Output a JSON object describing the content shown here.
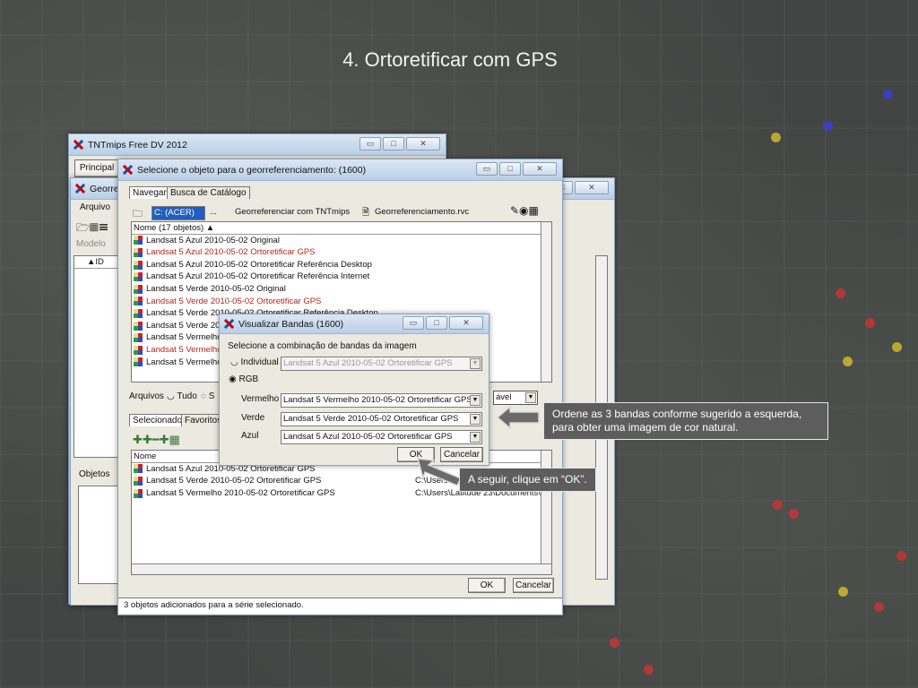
{
  "slide": {
    "title": "4. Ortoretificar com GPS"
  },
  "tnt_window": {
    "title": "TNTmips Free DV 2012",
    "menu_principal": "Principal"
  },
  "georef_window": {
    "title": "Georrefe",
    "menu_arquivo": "Arquivo",
    "modelo_label": "Modelo",
    "col_id": "ID",
    "objetos_label": "Objetos"
  },
  "select_dialog": {
    "title": "Selecione o objeto para o georreferenciamento: (1600)",
    "tab_navegar": "Navegar",
    "tab_busca": "Busca de Catálogo",
    "path": {
      "drive": "C: (ACER)",
      "ellipsis": "...",
      "folder": "Georreferenciar com TNTmips",
      "file": "Georreferenciamento.rvc"
    },
    "list_header": "Nome  (17 objetos)",
    "items": [
      {
        "label": "Landsat 5 Azul 2010-05-02 Original",
        "highlight": false
      },
      {
        "label": "Landsat 5 Azul 2010-05-02 Ortoretificar GPS",
        "highlight": true
      },
      {
        "label": "Landsat 5 Azul 2010-05-02 Ortoretificar Referência Desktop",
        "highlight": false
      },
      {
        "label": "Landsat 5 Azul 2010-05-02 Ortoretificar Referência Internet",
        "highlight": false
      },
      {
        "label": "Landsat 5 Verde 2010-05-02 Original",
        "highlight": false
      },
      {
        "label": "Landsat 5 Verde 2010-05-02 Ortoretificar GPS",
        "highlight": true
      },
      {
        "label": "Landsat 5 Verde 2010-05-02 Ortoretificar Referência Desktop",
        "highlight": false
      },
      {
        "label": "Landsat 5 Verde 20",
        "highlight": false
      },
      {
        "label": "Landsat 5 Vermelho",
        "highlight": false
      },
      {
        "label": "Landsat 5 Vermelho",
        "highlight": true
      },
      {
        "label": "Landsat 5 Vermelho",
        "highlight": false
      }
    ],
    "arquivos_label": "Arquivos",
    "tudo_label": "Tudo",
    "s_label": "S",
    "filter_value": "ável",
    "tab_selecionado": "Selecionado",
    "tab_favoritos": "Favoritos",
    "selected_header_nome": "Nome",
    "selected_items": [
      {
        "name": "Landsat 5 Azul 2010-05-02 Ortoretificar GPS",
        "path": ""
      },
      {
        "name": "Landsat 5 Verde 2010-05-02 Ortoretificar GPS",
        "path": "C:\\Users\\"
      },
      {
        "name": "Landsat 5 Vermelho 2010-05-02 Ortoretificar GPS",
        "path": "C:\\Users\\Latitude 23\\Documents\\"
      }
    ],
    "ok_label": "OK",
    "cancel_label": "Cancelar",
    "status": "3 objetos adicionados para a série selecionado."
  },
  "bands_dialog": {
    "title": "Visualizar Bandas (1600)",
    "prompt": "Selecione a combinação de bandas da imagem",
    "individual_label": "Individual",
    "individual_value": "Landsat 5 Azul 2010-05-02 Ortoretificar GPS",
    "rgb_label": "RGB",
    "vermelho_label": "Vermelho",
    "vermelho_value": "Landsat 5 Vermelho 2010-05-02 Ortoretificar GPS",
    "verde_label": "Verde",
    "verde_value": "Landsat 5 Verde 2010-05-02 Ortoretificar GPS",
    "azul_label": "Azul",
    "azul_value": "Landsat 5 Azul 2010-05-02 Ortoretificar GPS",
    "ok_label": "OK",
    "cancel_label": "Cancelar"
  },
  "callouts": {
    "bands": "Ordene as 3 bandas conforme sugerido a esquerda, para obter uma imagem de cor natural.",
    "ok": "A seguir, clique em “OK”."
  },
  "colors": {
    "highlight_text": "#b3261e",
    "drive_selected": "#1f5fbf",
    "callout_bg": "#5d5d5d"
  }
}
